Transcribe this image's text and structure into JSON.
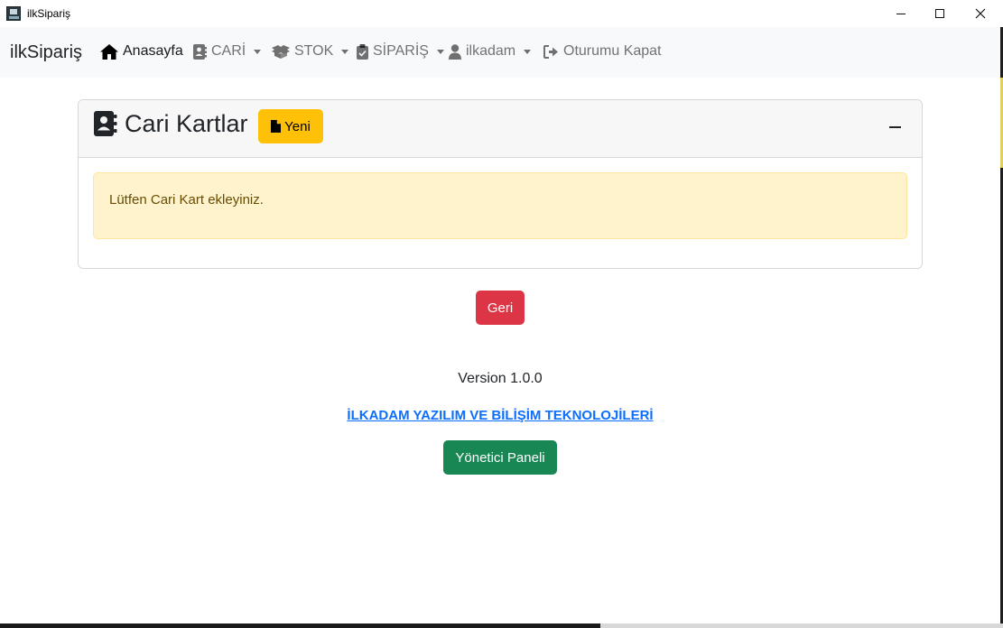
{
  "window": {
    "title": "ilkSipariş"
  },
  "navbar": {
    "brand": "ilkSipariş",
    "items": [
      {
        "label": "Anasayfa",
        "icon": "home-icon"
      },
      {
        "label": "CARİ",
        "icon": "address-book-icon"
      },
      {
        "label": "STOK",
        "icon": "boxes-icon"
      },
      {
        "label": "SİPARİŞ",
        "icon": "clipboard-check-icon"
      },
      {
        "label": "ilkadam",
        "icon": "user-icon"
      },
      {
        "label": "Oturumu Kapat",
        "icon": "sign-out-icon"
      }
    ]
  },
  "card": {
    "title": "Cari Kartlar",
    "new_button": "Yeni",
    "alert": "Lütfen Cari Kart ekleyiniz."
  },
  "actions": {
    "back_button": "Geri",
    "version": "Version 1.0.0",
    "company_link": "İLKADAM YAZILIM VE BİLİŞİM TEKNOLOJİLERİ",
    "admin_button": "Yönetici Paneli"
  },
  "colors": {
    "warning": "#ffc107",
    "danger": "#dc3545",
    "success": "#198754",
    "link": "#0d6efd",
    "alert_bg": "#fff3cd"
  }
}
